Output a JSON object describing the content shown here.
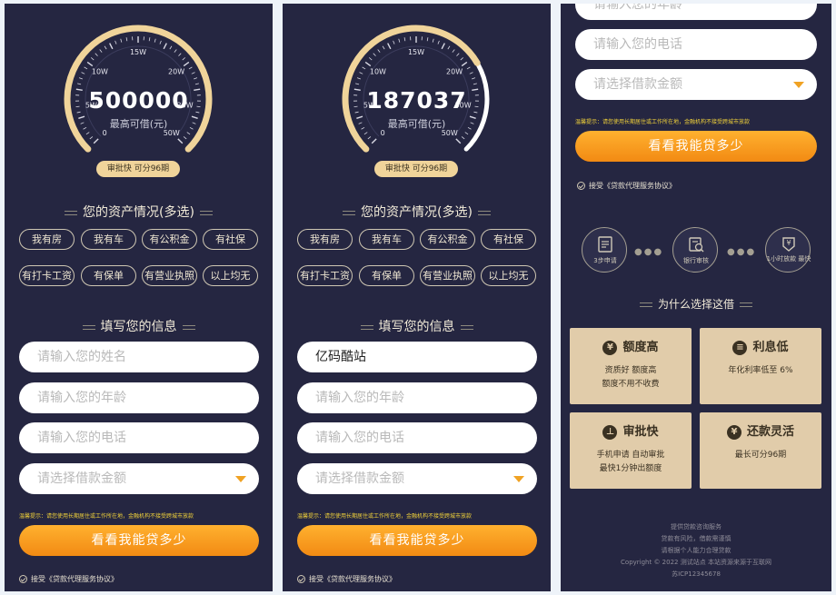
{
  "gauge_marks": {
    "m0": "0",
    "m5": "5W",
    "m10": "10W",
    "m15": "15W",
    "m20": "20W",
    "m30": "30W",
    "m50": "50W"
  },
  "gauge_sub": "最高可借(元)",
  "gauge_badge": "审批快  可分96期",
  "panel1": {
    "amount": "500000",
    "progress": 1.0
  },
  "panel2": {
    "amount": "187037",
    "progress": 0.72
  },
  "assets_title": "您的资产情况(多选)",
  "asset_tags": [
    "我有房",
    "我有车",
    "有公积金",
    "有社保",
    "有打卡工资",
    "有保单",
    "有营业执照",
    "以上均无"
  ],
  "info_title": "填写您的信息",
  "inputs": {
    "name_placeholder": "请输入您的姓名",
    "name_value": "亿码酷站",
    "age_placeholder": "请输入您的年龄",
    "phone_placeholder": "请输入您的电话",
    "amount_placeholder": "请选择借款金额"
  },
  "notice": "温馨提示：请您使用长期居住或工作所在地，金融机构不接受跨城市放款",
  "cta": "看看我能贷多少",
  "agree": "接受《贷款代理服务协议》",
  "steps": [
    {
      "label": "3步申请",
      "icon": "form-icon"
    },
    {
      "label": "银行审核",
      "icon": "bank-review-icon"
    },
    {
      "label": "1小时放款 最快",
      "icon": "yen-download-icon"
    }
  ],
  "why_title": "为什么选择这借",
  "cards": [
    {
      "title": "额度高",
      "icon": "yen-card-icon",
      "desc1": "资质好   额度高",
      "desc2": "额度不用不收费"
    },
    {
      "title": "利息低",
      "icon": "coins-icon",
      "desc1": "年化利率低至 6%",
      "desc2": ""
    },
    {
      "title": "审批快",
      "icon": "stamp-icon",
      "desc1": "手机申请 自动审批",
      "desc2": "最快1分钟出额度"
    },
    {
      "title": "还款灵活",
      "icon": "yen-circle-icon",
      "desc1": "最长可分96期",
      "desc2": ""
    }
  ],
  "footer": [
    "提供贷款咨询服务",
    "贷款有风险，借款需谨慎",
    "请根据个人能力合理贷款",
    "Copyright © 2022 测试站点 本站资源来源于互联网",
    "苏ICP12345678"
  ],
  "colors": {
    "panel_bg": "#252641",
    "accent": "#f28a13",
    "gold": "#f0d49a",
    "card": "#e1ccaa"
  }
}
